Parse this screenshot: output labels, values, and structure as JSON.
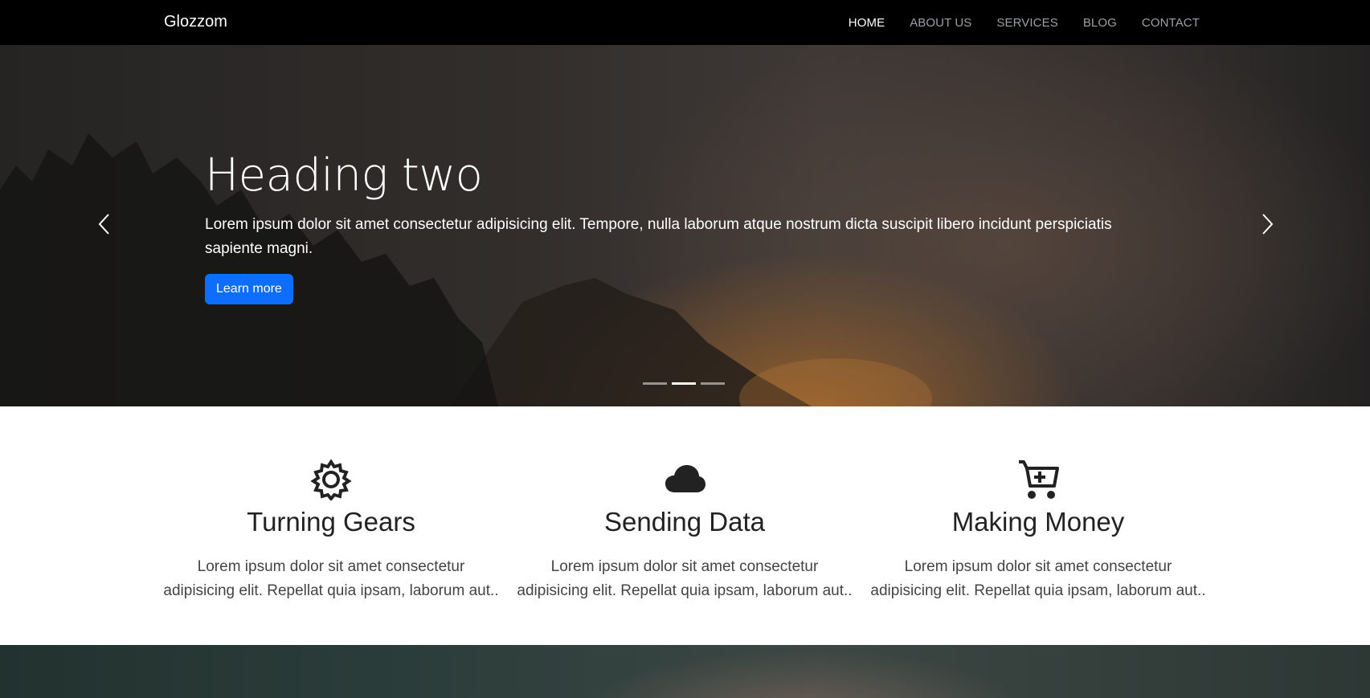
{
  "navbar": {
    "brand": "Glozzom",
    "items": [
      {
        "label": "HOME",
        "active": true
      },
      {
        "label": "ABOUT US",
        "active": false
      },
      {
        "label": "SERVICES",
        "active": false
      },
      {
        "label": "BLOG",
        "active": false
      },
      {
        "label": "CONTACT",
        "active": false
      }
    ]
  },
  "hero": {
    "title": "Heading two",
    "text": "Lorem ipsum dolor sit amet consectetur adipisicing elit. Tempore, nulla laborum atque nostrum dicta suscipit libero incidunt perspiciatis sapiente magni.",
    "button_label": "Learn more",
    "indicators": {
      "count": 3,
      "active_index": 1
    }
  },
  "features": [
    {
      "icon": "gear-icon",
      "title": "Turning Gears",
      "text": "Lorem ipsum dolor sit amet consectetur adipisicing elit. Repellat quia ipsam, laborum aut.."
    },
    {
      "icon": "cloud-icon",
      "title": "Sending Data",
      "text": "Lorem ipsum dolor sit amet consectetur adipisicing elit. Repellat quia ipsam, laborum aut.."
    },
    {
      "icon": "cart-plus-icon",
      "title": "Making Money",
      "text": "Lorem ipsum dolor sit amet consectetur adipisicing elit. Repellat quia ipsam, laborum aut.."
    }
  ],
  "colors": {
    "navbar_bg": "#000000",
    "primary_button": "#0d6efd",
    "nav_active": "#ffffff",
    "nav_inactive": "#9aa0a6"
  }
}
